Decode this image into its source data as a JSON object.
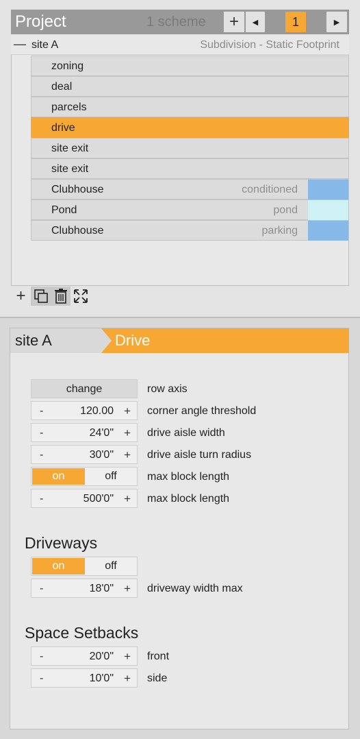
{
  "project": {
    "title": "Project",
    "scheme_count": "1 scheme",
    "add_label": "+",
    "prev_label": "◀",
    "current_scheme": "1",
    "next_label": "▶"
  },
  "site": {
    "collapse_label": "—",
    "name": "site A",
    "type": "Subdivision - Static Footprint"
  },
  "items": [
    {
      "label": "zoning"
    },
    {
      "label": "deal"
    },
    {
      "label": "parcels"
    },
    {
      "label": "drive",
      "selected": true
    },
    {
      "label": "site exit"
    },
    {
      "label": "site exit"
    },
    {
      "label": "Clubhouse",
      "sub": "conditioned",
      "color": "#86b8e8"
    },
    {
      "label": "Pond",
      "sub": "pond",
      "color": "#cff1f3"
    },
    {
      "label": "Clubhouse",
      "sub": "parking",
      "color": "#86b8e8"
    }
  ],
  "toolbar": {
    "add_label": "+",
    "icons": [
      "duplicate-icon",
      "trash-icon",
      "fullscreen-icon"
    ]
  },
  "breadcrumb": {
    "site": "site A",
    "current": "Drive"
  },
  "params": {
    "row_axis": {
      "button": "change",
      "label": "row axis"
    },
    "corner_angle": {
      "minus": "-",
      "value": "120.00",
      "plus": "+",
      "label": "corner angle threshold"
    },
    "aisle_width": {
      "minus": "-",
      "value": "24'0\"",
      "plus": "+",
      "label": "drive aisle width"
    },
    "turn_radius": {
      "minus": "-",
      "value": "30'0\"",
      "plus": "+",
      "label": "drive aisle turn radius"
    },
    "block_toggle": {
      "on": "on",
      "off": "off",
      "label": "max block length",
      "state": "on"
    },
    "block_length": {
      "minus": "-",
      "value": "500'0\"",
      "plus": "+",
      "label": "max block length"
    }
  },
  "driveways": {
    "title": "Driveways",
    "toggle": {
      "on": "on",
      "off": "off",
      "state": "on"
    },
    "width_max": {
      "minus": "-",
      "value": "18'0\"",
      "plus": "+",
      "label": "driveway width max"
    }
  },
  "setbacks": {
    "title": "Space Setbacks",
    "front": {
      "minus": "-",
      "value": "20'0\"",
      "plus": "+",
      "label": "front"
    },
    "side": {
      "minus": "-",
      "value": "10'0\"",
      "plus": "+",
      "label": "side"
    }
  },
  "colors": {
    "accent": "#f7a733",
    "conditioned": "#86b8e8",
    "pond": "#cff1f3"
  }
}
